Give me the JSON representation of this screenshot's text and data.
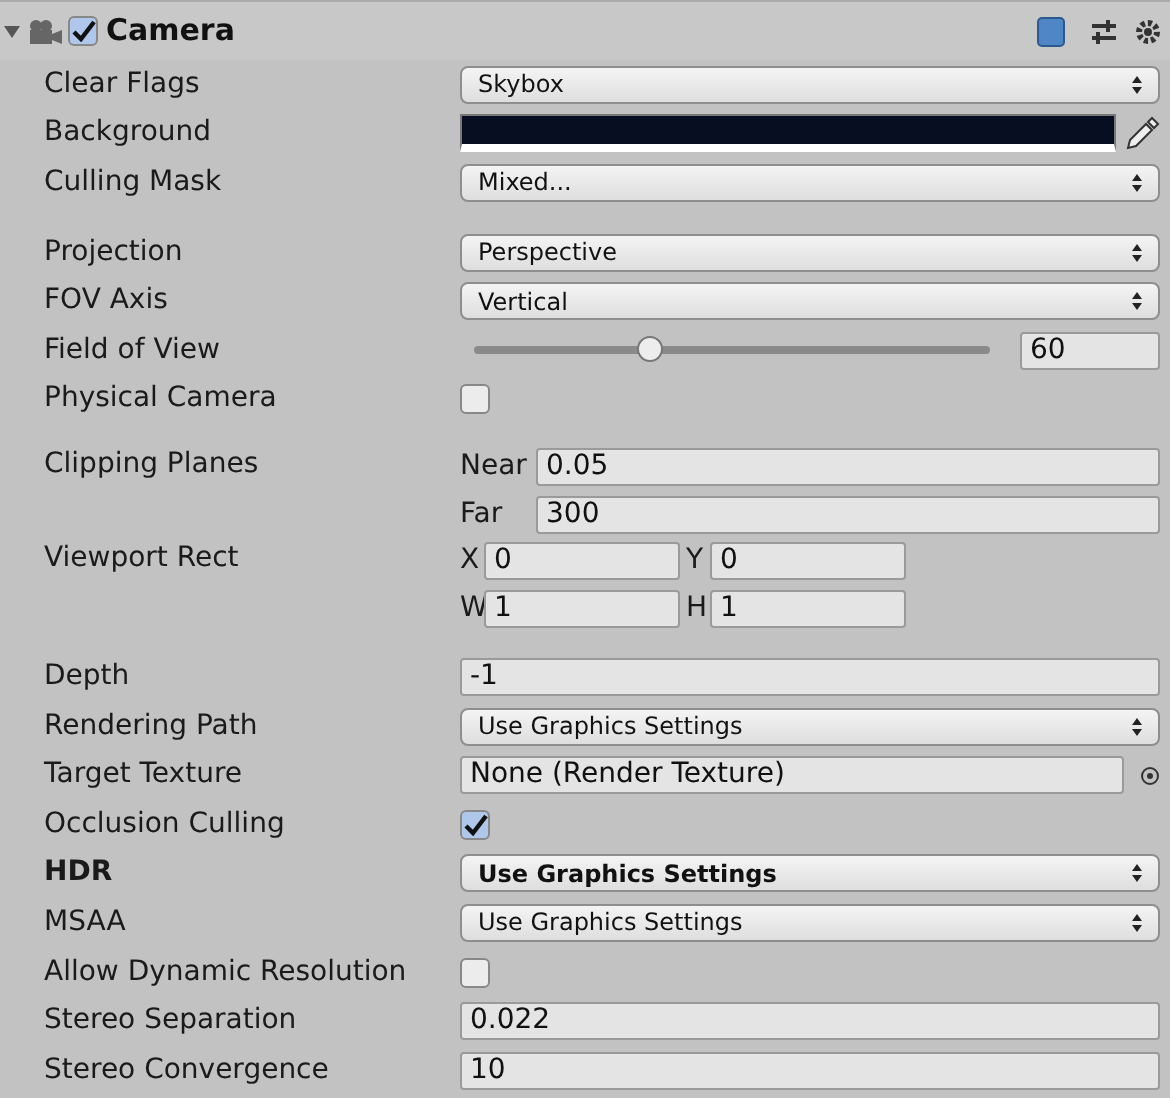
{
  "header": {
    "title": "Camera",
    "enabled": true
  },
  "sections": [
    {
      "rows": [
        {
          "kind": "dropdown",
          "label": "Clear Flags",
          "value": "Skybox",
          "bold": false
        },
        {
          "kind": "color",
          "label": "Background",
          "color": "#070e21"
        },
        {
          "kind": "dropdown",
          "label": "Culling Mask",
          "value": "Mixed...",
          "bold": false
        }
      ]
    },
    {
      "rows": [
        {
          "kind": "dropdown",
          "label": "Projection",
          "value": "Perspective",
          "bold": false
        },
        {
          "kind": "dropdown",
          "label": "FOV Axis",
          "value": "Vertical",
          "bold": false
        },
        {
          "kind": "slider",
          "label": "Field of View",
          "level": 0.34,
          "value": "60"
        },
        {
          "kind": "checkbox",
          "label": "Physical Camera",
          "checked": false
        }
      ]
    },
    {
      "rows": [
        {
          "kind": "pairs",
          "label": "Clipping Planes",
          "fields": [
            {
              "label": "Near",
              "value": "0.05"
            },
            {
              "label": "Far",
              "value": "300"
            }
          ]
        },
        {
          "kind": "rect",
          "label": "Viewport Rect",
          "fields": [
            {
              "label": "X",
              "value": "0"
            },
            {
              "label": "Y",
              "value": "0"
            },
            {
              "label": "W",
              "value": "1"
            },
            {
              "label": "H",
              "value": "1"
            }
          ]
        }
      ]
    },
    {
      "rows": [
        {
          "kind": "number",
          "label": "Depth",
          "value": "-1"
        },
        {
          "kind": "dropdown",
          "label": "Rendering Path",
          "value": "Use Graphics Settings",
          "bold": false
        },
        {
          "kind": "object",
          "label": "Target Texture",
          "value": "None (Render Texture)"
        },
        {
          "kind": "checkbox",
          "label": "Occlusion Culling",
          "checked": true
        },
        {
          "kind": "dropdown",
          "label": "HDR",
          "value": "Use Graphics Settings",
          "bold": true
        },
        {
          "kind": "dropdown",
          "label": "MSAA",
          "value": "Use Graphics Settings",
          "bold": false
        },
        {
          "kind": "checkbox",
          "label": "Allow Dynamic Resolution",
          "checked": false
        },
        {
          "kind": "number",
          "label": "Stereo Separation",
          "value": "0.022"
        },
        {
          "kind": "number",
          "label": "Stereo Convergence",
          "value": "10"
        }
      ]
    }
  ]
}
